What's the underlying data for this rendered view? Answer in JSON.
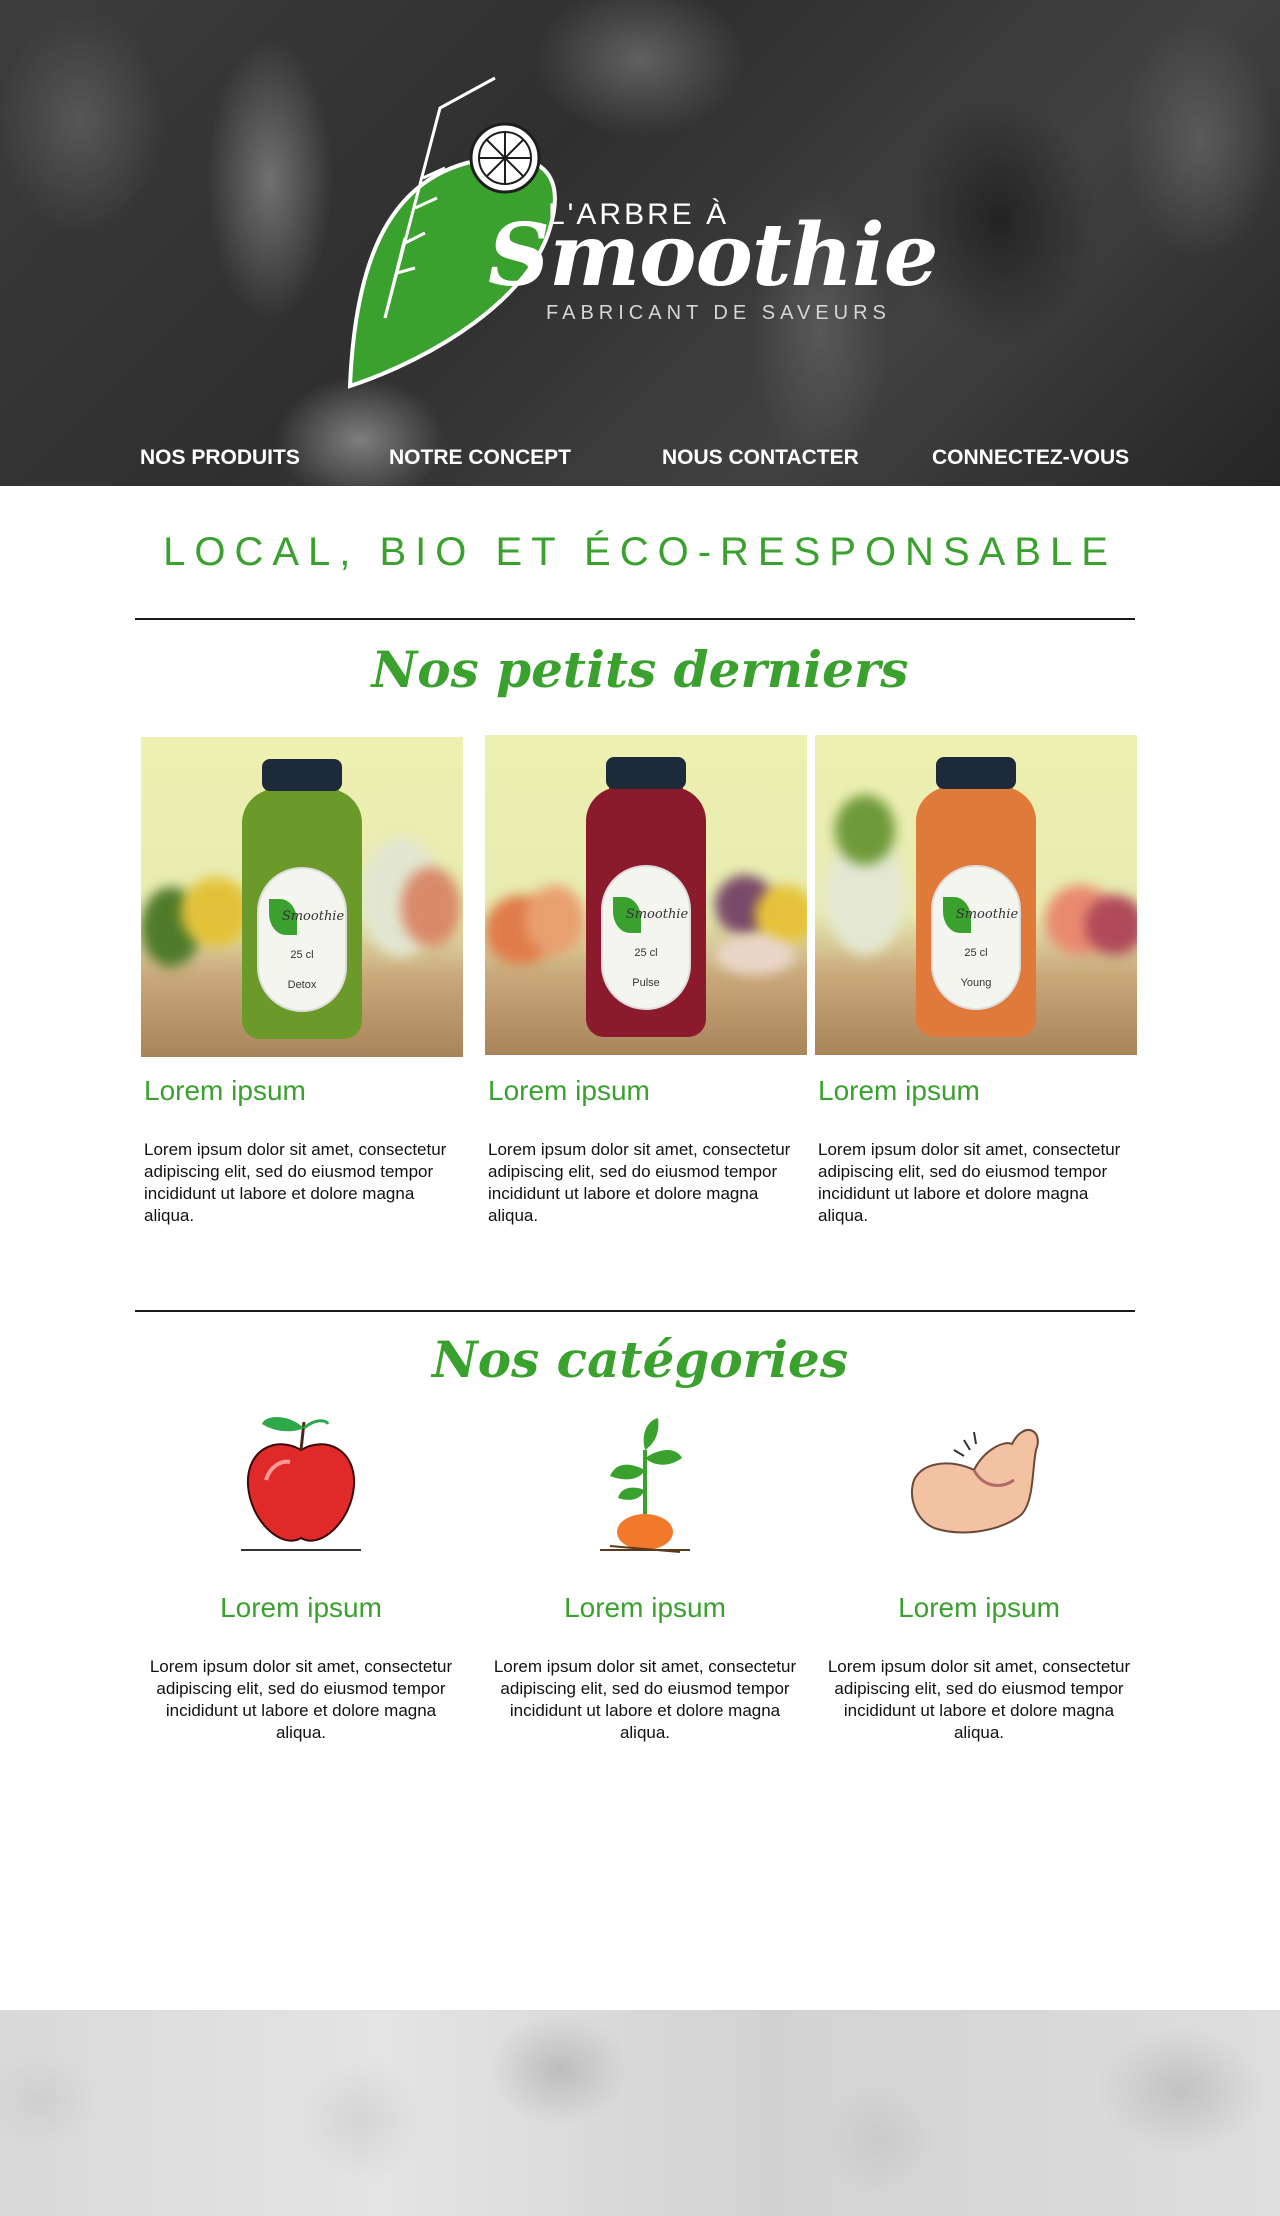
{
  "brand": {
    "small": "L'ARBRE À",
    "name": "Smoothie",
    "tagline": "FABRICANT DE SAVEURS",
    "leaf_color": "#3aa12e"
  },
  "nav": {
    "items": [
      {
        "label": "NOS PRODUITS"
      },
      {
        "label": "NOTRE CONCEPT"
      },
      {
        "label": "NOUS CONTACTER"
      },
      {
        "label": "CONNECTEZ-VOUS"
      }
    ]
  },
  "headline": "LOCAL, BIO ET ÉCO-RESPONSABLE",
  "latest": {
    "title": "Nos petits derniers",
    "products": [
      {
        "bottle_label": {
          "brand": "Smoothie",
          "volume": "25 cl",
          "name": "Detox"
        },
        "bottle_color": "#6b9a2a",
        "title": "Lorem ipsum",
        "description": "Lorem ipsum dolor sit amet, consectetur adipiscing elit, sed do eiusmod tempor incididunt ut labore et dolore magna aliqua."
      },
      {
        "bottle_label": {
          "brand": "Smoothie",
          "volume": "25 cl",
          "name": "Pulse"
        },
        "bottle_color": "#8a1a2c",
        "title": "Lorem ipsum",
        "description": "Lorem ipsum dolor sit amet, consectetur adipiscing elit, sed do eiusmod tempor incididunt ut labore et dolore magna aliqua."
      },
      {
        "bottle_label": {
          "brand": "Smoothie",
          "volume": "25 cl",
          "name": "Young"
        },
        "bottle_color": "#e07a3a",
        "title": "Lorem ipsum",
        "description": "Lorem ipsum dolor sit amet, consectetur adipiscing elit, sed do eiusmod tempor incididunt ut labore et dolore magna aliqua."
      }
    ]
  },
  "categories": {
    "title": "Nos catégories",
    "items": [
      {
        "icon": "apple-icon",
        "title": "Lorem ipsum",
        "description": "Lorem ipsum dolor sit amet, consectetur adipiscing elit, sed do eiusmod tempor incididunt ut labore et dolore magna aliqua."
      },
      {
        "icon": "sprout-icon",
        "title": "Lorem ipsum",
        "description": "Lorem ipsum dolor sit amet, consectetur adipiscing elit, sed do eiusmod tempor incididunt ut labore et dolore magna aliqua."
      },
      {
        "icon": "muscle-arm-icon",
        "title": "Lorem ipsum",
        "description": "Lorem ipsum dolor sit amet, consectetur adipiscing elit, sed do eiusmod tempor incididunt ut labore et dolore magna aliqua."
      }
    ]
  },
  "colors": {
    "accent": "#3aa12e",
    "divider": "#1a1a1a",
    "nav_text": "#ffffff"
  }
}
